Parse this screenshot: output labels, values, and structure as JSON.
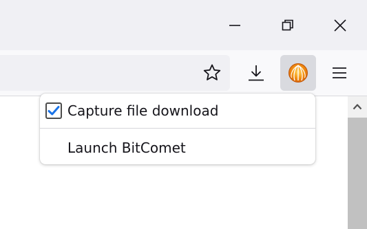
{
  "window_controls": {
    "minimize": "minimize-icon",
    "restore": "restore-icon",
    "close": "close-icon"
  },
  "toolbar": {
    "bookmark_icon": "star-icon",
    "downloads_icon": "download-icon",
    "extension_icon": "bitcomet-icon",
    "menu_icon": "hamburger-menu-icon"
  },
  "popup_menu": {
    "items": [
      {
        "label": "Capture file download",
        "checked": true
      },
      {
        "label": "Launch BitComet"
      }
    ]
  },
  "colors": {
    "checkbox_check": "#1a73e8",
    "bitcomet_orange": "#f39313",
    "active_button_bg": "#d9dadf"
  }
}
